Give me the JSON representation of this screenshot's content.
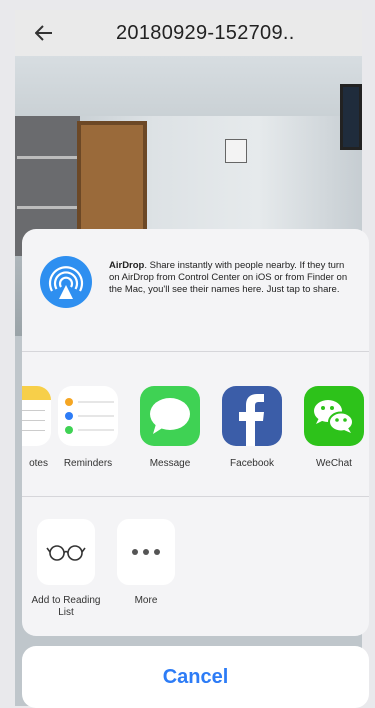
{
  "header": {
    "back_icon": "back-arrow-icon",
    "title": "20180929-152709.."
  },
  "share_sheet": {
    "airdrop": {
      "icon": "airdrop-icon",
      "title": "AirDrop",
      "description": ". Share instantly with people nearby. If they turn on AirDrop from Control Center on iOS or from Finder on the Mac, you'll see their names here. Just tap to share."
    },
    "apps": [
      {
        "label": "otes",
        "icon": "notes-icon"
      },
      {
        "label": "Reminders",
        "icon": "reminders-icon"
      },
      {
        "label": "Message",
        "icon": "message-icon"
      },
      {
        "label": "Facebook",
        "icon": "facebook-icon"
      },
      {
        "label": "WeChat",
        "icon": "wechat-icon"
      }
    ],
    "actions": [
      {
        "label": "Add to Reading List",
        "icon": "reading-glasses-icon"
      },
      {
        "label": "More",
        "icon": "more-dots-icon"
      }
    ],
    "cancel_label": "Cancel"
  },
  "colors": {
    "accent": "#2d7cf6",
    "message_green": "#3fd254",
    "facebook_blue": "#3b5da8",
    "wechat_green": "#2dc21a"
  }
}
